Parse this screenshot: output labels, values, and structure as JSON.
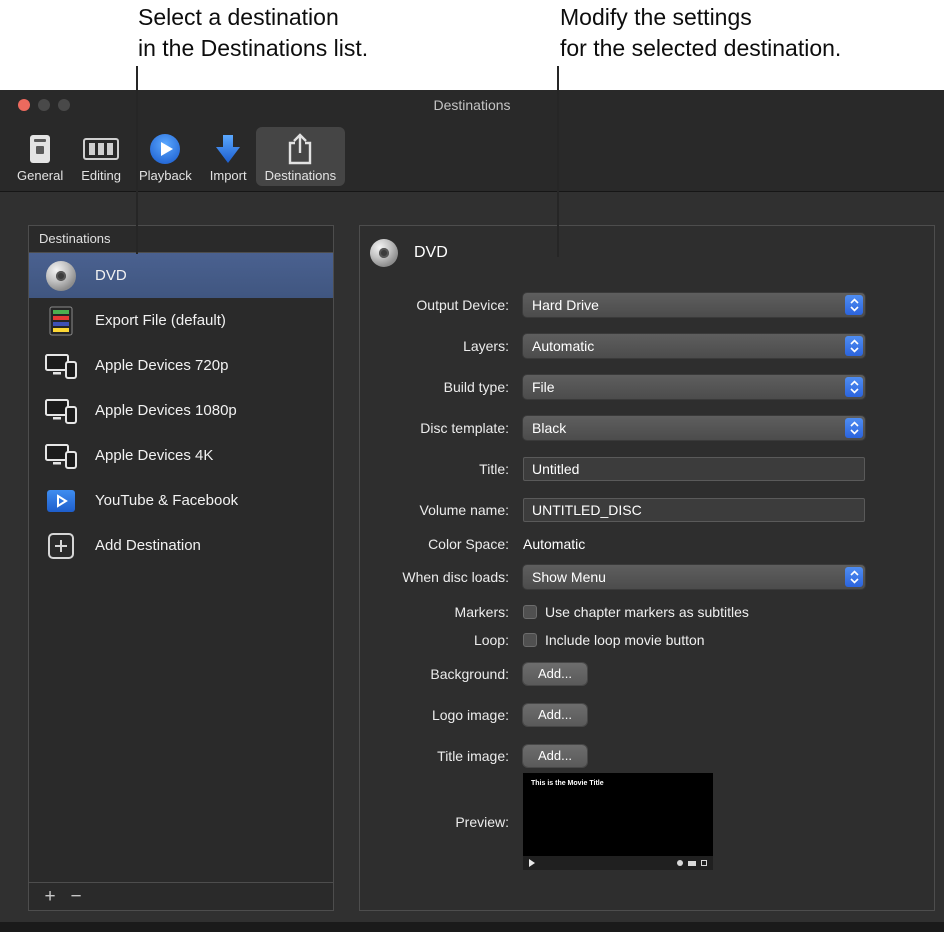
{
  "annotations": {
    "left_line1": "Select a destination",
    "left_line2": "in the Destinations list.",
    "right_line1": "Modify the settings",
    "right_line2": "for the selected destination."
  },
  "colors": {
    "accent_blue": "#3478f6",
    "selection_blue": "#45608c",
    "window_bg": "#303030"
  },
  "window": {
    "title": "Destinations",
    "toolbar": {
      "items": [
        {
          "label": "General"
        },
        {
          "label": "Editing"
        },
        {
          "label": "Playback"
        },
        {
          "label": "Import"
        },
        {
          "label": "Destinations"
        }
      ]
    },
    "sidebar": {
      "header": "Destinations",
      "items": [
        {
          "label": "DVD"
        },
        {
          "label": "Export File (default)"
        },
        {
          "label": "Apple Devices 720p"
        },
        {
          "label": "Apple Devices 1080p"
        },
        {
          "label": "Apple Devices 4K"
        },
        {
          "label": "YouTube & Facebook"
        },
        {
          "label": "Add Destination"
        }
      ],
      "add_button": "+",
      "remove_button": "−"
    },
    "panel": {
      "title": "DVD",
      "rows": {
        "output_device": {
          "label": "Output Device:",
          "value": "Hard Drive"
        },
        "layers": {
          "label": "Layers:",
          "value": "Automatic"
        },
        "build_type": {
          "label": "Build type:",
          "value": "File"
        },
        "disc_template": {
          "label": "Disc template:",
          "value": "Black"
        },
        "title": {
          "label": "Title:",
          "value": "Untitled"
        },
        "volume_name": {
          "label": "Volume name:",
          "value": "UNTITLED_DISC"
        },
        "color_space": {
          "label": "Color Space:",
          "value": "Automatic"
        },
        "when_disc_loads": {
          "label": "When disc loads:",
          "value": "Show Menu"
        },
        "markers": {
          "label": "Markers:",
          "value": "Use chapter markers as subtitles"
        },
        "loop": {
          "label": "Loop:",
          "value": "Include loop movie button"
        },
        "background": {
          "label": "Background:",
          "button": "Add..."
        },
        "logo_image": {
          "label": "Logo image:",
          "button": "Add..."
        },
        "title_image": {
          "label": "Title image:",
          "button": "Add..."
        },
        "preview": {
          "label": "Preview:",
          "movie_title": "This is the Movie Title"
        }
      }
    }
  }
}
